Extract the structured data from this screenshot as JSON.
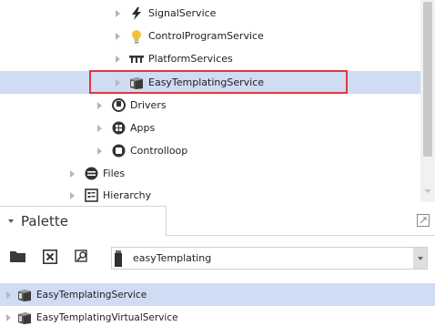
{
  "tree": {
    "items": [
      {
        "label": "SignalService",
        "icon": "lightning-icon"
      },
      {
        "label": "ControlProgramService",
        "icon": "lightbulb-icon"
      },
      {
        "label": "PlatformServices",
        "icon": "platform-icon"
      },
      {
        "label": "EasyTemplatingService",
        "icon": "box-icon",
        "selected": true
      },
      {
        "label": "Drivers",
        "icon": "drivers-icon"
      },
      {
        "label": "Apps",
        "icon": "apps-icon"
      },
      {
        "label": "Controlloop",
        "icon": "controlloop-icon"
      },
      {
        "label": "Files",
        "icon": "files-icon"
      },
      {
        "label": "Hierarchy",
        "icon": "hierarchy-icon"
      }
    ]
  },
  "palette": {
    "title": "Palette",
    "module_value": "easyTemplating",
    "items": [
      {
        "label": "EasyTemplatingService",
        "selected": true
      },
      {
        "label": "EasyTemplatingVirtualService",
        "selected": false
      }
    ]
  },
  "colors": {
    "selection": "#cfdcf3",
    "highlight_border": "#e0383e",
    "scroll_thumb": "#c9c9c9"
  }
}
